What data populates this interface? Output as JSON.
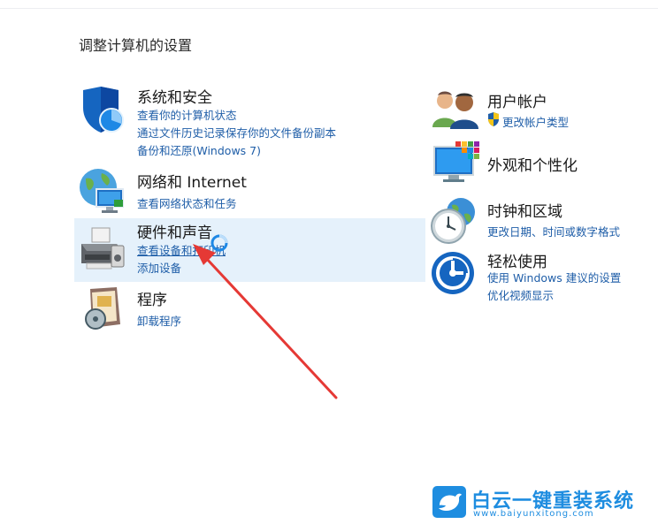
{
  "page": {
    "title": "调整计算机的设置"
  },
  "left_categories": [
    {
      "title": "系统和安全",
      "links": [
        "查看你的计算机状态",
        "通过文件历史记录保存你的文件备份副本",
        "备份和还原(Windows 7)"
      ]
    },
    {
      "title": "网络和 Internet",
      "links": [
        "查看网络状态和任务"
      ]
    },
    {
      "title": "硬件和声音",
      "links": [
        "查看设备和打印机",
        "添加设备"
      ]
    },
    {
      "title": "程序",
      "links": [
        "卸载程序"
      ]
    }
  ],
  "right_categories": [
    {
      "title": "用户帐户",
      "links": [
        "更改帐户类型"
      ]
    },
    {
      "title": "外观和个性化",
      "links": []
    },
    {
      "title": "时钟和区域",
      "links": [
        "更改日期、时间或数字格式"
      ]
    },
    {
      "title": "轻松使用",
      "links": [
        "使用 Windows 建议的设置",
        "优化视频显示"
      ]
    }
  ],
  "watermark": {
    "text": "白云一键重装系统",
    "url": "www.baiyunxitong.com"
  },
  "icons": {
    "security": "shield-icon",
    "network": "network-globe-icon",
    "hardware": "printer-icon",
    "programs": "programs-disc-icon",
    "users": "users-icon",
    "uac": "uac-shield-icon",
    "appearance": "display-palette-icon",
    "clock": "clock-globe-icon",
    "access": "ease-of-access-icon",
    "cursor": "busy-cursor-icon",
    "arrow": "red-arrow-annotation",
    "watermark": "bird-logo-icon"
  },
  "colors": {
    "link": "#1f5ea8",
    "highlight": "#e5f1fb",
    "arrow": "#e53935",
    "watermark": "#1e8de0"
  }
}
